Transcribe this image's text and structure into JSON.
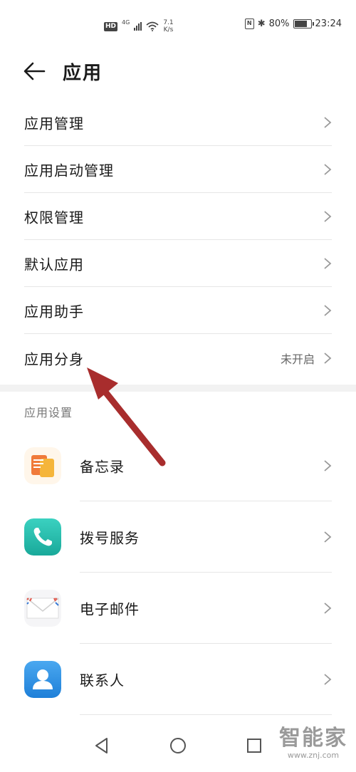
{
  "status_bar": {
    "hd": "HD",
    "network": "4G",
    "speed_value": "7.1",
    "speed_unit": "K/s",
    "battery": "80%",
    "battery_level": 0.8,
    "time": "23:24"
  },
  "header": {
    "title": "应用"
  },
  "menu": {
    "items": [
      {
        "label": "应用管理",
        "value": ""
      },
      {
        "label": "应用启动管理",
        "value": ""
      },
      {
        "label": "权限管理",
        "value": ""
      },
      {
        "label": "默认应用",
        "value": ""
      },
      {
        "label": "应用助手",
        "value": ""
      },
      {
        "label": "应用分身",
        "value": "未开启"
      }
    ]
  },
  "app_settings": {
    "title": "应用设置",
    "apps": [
      {
        "label": "备忘录",
        "icon": "notepad-icon"
      },
      {
        "label": "拨号服务",
        "icon": "phone-icon"
      },
      {
        "label": "电子邮件",
        "icon": "email-icon"
      },
      {
        "label": "联系人",
        "icon": "contacts-icon"
      }
    ]
  },
  "watermark": {
    "brand": "智能家",
    "url": "www.znj.com"
  },
  "annotation": {
    "arrow_color": "#a82d2d"
  }
}
